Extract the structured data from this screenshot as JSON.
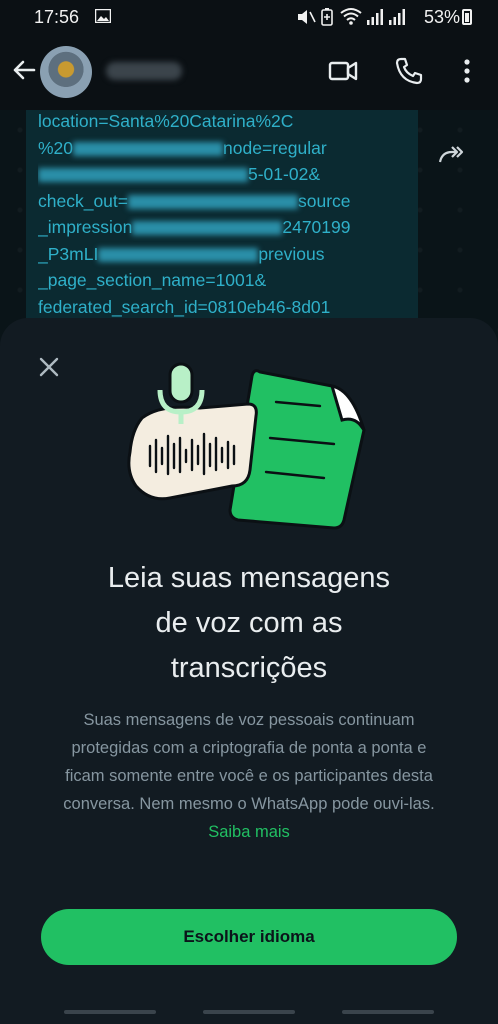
{
  "status_bar": {
    "time": "17:56",
    "battery": "53%"
  },
  "chat_header": {
    "icons": [
      "back-arrow-icon",
      "video-call-icon",
      "voice-call-icon",
      "more-vertical-icon"
    ]
  },
  "message": {
    "lines": [
      "location=Santa%20Catarina%2C",
      "%20",
      "check_out=",
      "_impression",
      "_P3mLI",
      "_page_section_name=1001&",
      "federated_search_id=0810eb46-8d01"
    ],
    "fragments": {
      "node": "node=regular",
      "date": "5-01-02&",
      "source": "source",
      "num": "2470199",
      "previous": "previous"
    }
  },
  "sheet": {
    "title_lines": [
      "Leia suas mensagens",
      "de voz com as",
      "transcrições"
    ],
    "description": "Suas mensagens de voz pessoais continuam protegidas com a criptografia de ponta a ponta e ficam somente entre você e os participantes desta conversa. Nem mesmo o WhatsApp pode ouvi-las.",
    "learn_more": "Saiba mais",
    "button": "Escolher idioma"
  },
  "colors": {
    "accent": "#21c063",
    "sheet_bg": "#121b22",
    "text_secondary": "#8696a0"
  }
}
